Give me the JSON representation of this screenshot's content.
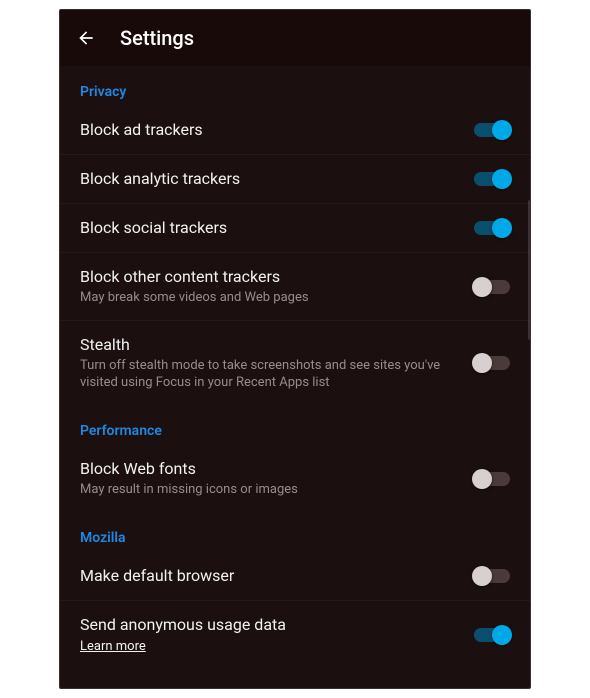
{
  "header": {
    "title": "Settings"
  },
  "sections": {
    "privacy": {
      "label": "Privacy",
      "items": {
        "block_ad": {
          "title": "Block ad trackers",
          "on": true
        },
        "block_analytic": {
          "title": "Block analytic trackers",
          "on": true
        },
        "block_social": {
          "title": "Block social trackers",
          "on": true
        },
        "block_other": {
          "title": "Block other content trackers",
          "sub": "May break some videos and Web pages",
          "on": false
        },
        "stealth": {
          "title": "Stealth",
          "sub": "Turn off stealth mode to take screenshots and see sites you've visited using Focus in your Recent Apps list",
          "on": false
        }
      }
    },
    "performance": {
      "label": "Performance",
      "items": {
        "block_fonts": {
          "title": "Block Web fonts",
          "sub": "May result in missing icons or images",
          "on": false
        }
      }
    },
    "mozilla": {
      "label": "Mozilla",
      "items": {
        "default_browser": {
          "title": "Make default browser",
          "on": false
        },
        "anon_data": {
          "title": "Send anonymous usage data",
          "link": "Learn more",
          "on": true
        }
      }
    }
  }
}
